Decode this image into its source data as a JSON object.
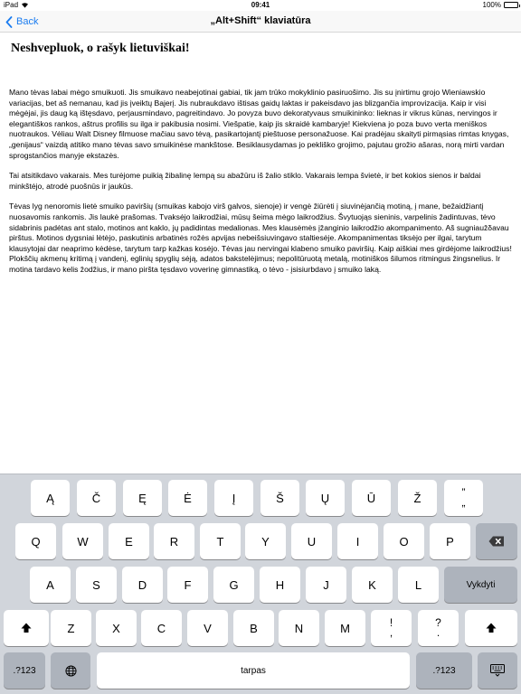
{
  "status_bar": {
    "device": "iPad",
    "time": "09:41",
    "battery": "100%",
    "battery_level": 1.0
  },
  "nav": {
    "back_label": "Back",
    "title": "„Alt+Shift“ klaviatūra"
  },
  "content": {
    "heading": "Neshvepluok, o rašyk lietuviškai!",
    "paragraphs": [
      "Mano tėvas labai mėgo smuikuoti. Jis smuikavo neabejotinai gabiai, tik jam trūko mokyklinio pasiruošimo. Jis su įnirtimu grojo Wieniawskio variacijas, bet aš nemanau, kad jis įveiktų Bajerį. Jis nubraukdavo ištisas gaidų laktas ir pakeisdavo jas blizgančia improvizacija. Kaip ir visi mėgėjai, jis daug ką ištęsdavo, perjausmindavo, pagreitindavo. Jo povyza buvo dekoratyvaus smuikininko: lieknas ir vikrus kūnas, nervingos ir elegantiškos rankos, aštrus profilis su ilga ir pakibusia nosimi. Viešpatie, kaip jis skraidė kambaryje! Kiekviena jo poza buvo verta meniškos nuotraukos. Vėliau Walt Disney filmuose mačiau savo tėvą, pasikartojantį pieštuose personažuose. Kai pradėjau skaityti pirmąsias rimtas knygas, „genijaus“ vaizdą atitiko mano tėvas savo smuikinėse mankštose. Besiklausydamas jo pekliško grojimo, pajutau grožio ašaras, norą mirti vardan sprogstančios manyje ekstazės.",
      "Tai atsitikdavo vakarais. Mes turėjome puikią žibalinę lempą su abažūru iš žalio stiklo. Vakarais lempa švietė, ir bet kokios sienos ir baldai minkštėjo, atrodė puošnūs ir jaukūs.",
      "Tėvas lyg nenoromis lietė smuiko paviršių (smuikas kabojo virš galvos, sienoje) ir vengė žiūrėti į siuvinėjančią motiną, į mane, bežaidžiantį nuosavomis rankomis. Jis laukė prašomas. Tvaksėjo laikrodžiai, mūsų šeima mėgo laikrodžius. Švytuojąs sieninis, varpelinis žadintuvas, tėvo sidabrinis padėtas ant stalo, motinos ant kaklo, jų padidintas medalionas. Mes klausėmės įžanginio laikrodžio akompanimento. Aš sugniaužδavau pirštus. Motinos dygsniai lėtėjo, paskutinis arbatinės rožės apvijas nebeišsiuvingavo staltiesėje. Akompanimentas tiksėjo per ilgai, tarytum klausytojai dar neaprimo kėdėse, tarytum tarp kažkas kosėjo. Tėvas jau nervingai klabeno smuiko paviršių. Kaip aiškiai mes girdėjome laikrodžius! Plokščių akmenų kritimą į vandenį, eglinių spyglių sėją, adatos bakstelėjimus; nepolitūruotą metalą, motiniškos šilumos ritmingus žingsnelius. Ir motina tardavo kelis žodžius, ir mano piršta tęsdavo voverinę gimnastiką, o tėvo - įsisiurbdavo į smuiko laką."
    ]
  },
  "keyboard": {
    "row1": [
      "Ą",
      "Č",
      "Ę",
      "Ė",
      "Į",
      "Š",
      "Ų",
      "Ū",
      "Ž"
    ],
    "row1_last": {
      "top": "”",
      "bottom": "„"
    },
    "row2": [
      "Q",
      "W",
      "E",
      "R",
      "T",
      "Y",
      "U",
      "I",
      "O",
      "P"
    ],
    "row3": [
      "A",
      "S",
      "D",
      "F",
      "G",
      "H",
      "J",
      "K",
      "L"
    ],
    "return_label": "Vykdyti",
    "row4": [
      "Z",
      "X",
      "C",
      "V",
      "B",
      "N",
      "M"
    ],
    "row4_punct": [
      {
        "top": "!",
        "bottom": ","
      },
      {
        "top": "?",
        "bottom": "."
      }
    ],
    "numbers_label": ".?123",
    "space_label": "tarpas"
  }
}
